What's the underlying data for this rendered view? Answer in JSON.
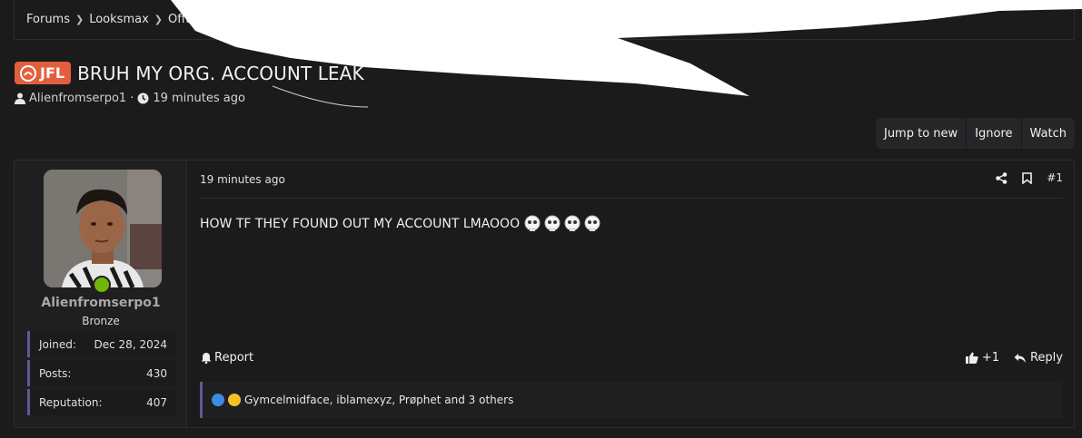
{
  "breadcrumb": {
    "items": [
      "Forums",
      "Looksmax",
      "Offtopic",
      "..."
    ]
  },
  "thread": {
    "prefix": "JFL",
    "title": "BRUH MY ORG. ACCOUNT LEAK",
    "author": "Alienfromserpo1",
    "separator": "·",
    "time": "19 minutes ago"
  },
  "actions": {
    "jump": "Jump to new",
    "ignore": "Ignore",
    "watch": "Watch"
  },
  "user": {
    "name": "Alienfromserpo1",
    "title": "Bronze",
    "stats": [
      {
        "label": "Joined:",
        "value": "Dec 28, 2024"
      },
      {
        "label": "Posts:",
        "value": "430"
      },
      {
        "label": "Reputation:",
        "value": "407"
      }
    ]
  },
  "post": {
    "date": "19 minutes ago",
    "number": "#1",
    "body": "HOW TF THEY FOUND OUT MY ACCOUNT LMAOOO",
    "report": "Report",
    "like_count": "+1",
    "reply": "Reply",
    "reactions_text": "Gymcelmidface, iblamexyz, Prøphet and 3 others"
  },
  "colors": {
    "background": "#1b1b1c",
    "prefix_badge": "#e25f3c",
    "online": "#73b60a",
    "accent_border": "#5a5a9a"
  }
}
